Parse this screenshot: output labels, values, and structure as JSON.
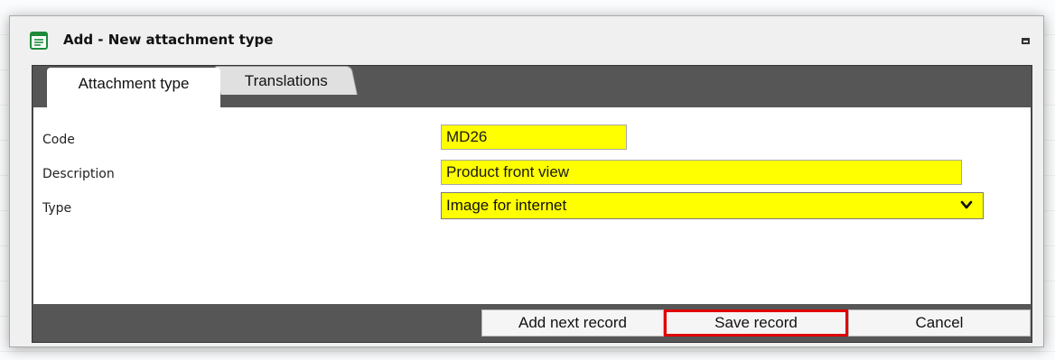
{
  "window": {
    "title": "Add - New attachment type",
    "icon": "form-icon",
    "maximize_icon": "maximize-icon"
  },
  "tabs": [
    {
      "label": "Attachment type",
      "active": true
    },
    {
      "label": "Translations",
      "active": false
    }
  ],
  "form": {
    "code": {
      "label": "Code",
      "value": "MD26"
    },
    "description": {
      "label": "Description",
      "value": "Product front view"
    },
    "type": {
      "label": "Type",
      "value": "Image for internet",
      "icon": "chevron-down-icon"
    }
  },
  "footer": {
    "add_next_label": "Add next record",
    "save_label": "Save record",
    "cancel_label": "Cancel"
  },
  "colors": {
    "field_highlight": "#ffff00",
    "panel_dark": "#565656",
    "save_outline": "#e00000",
    "title_icon_green": "#1e8a3a"
  }
}
